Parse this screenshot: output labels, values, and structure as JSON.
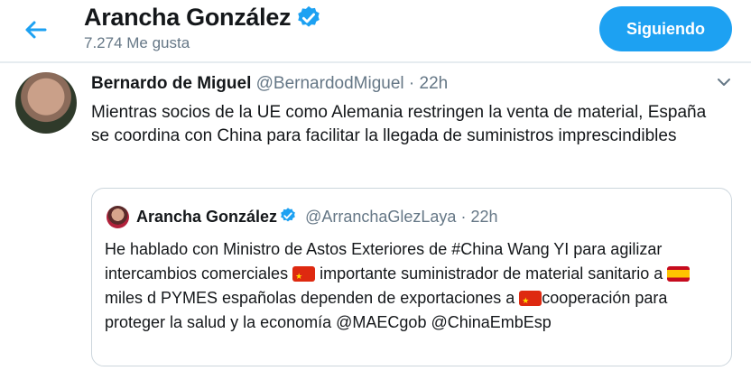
{
  "header": {
    "back_icon": "arrow-left-icon",
    "title": "Arancha González",
    "likes": "7.274 Me gusta",
    "follow_label": "Siguiendo",
    "accent": "#1da1f2"
  },
  "tweet": {
    "author_name": "Bernardo de Miguel",
    "author_handle": "@BernardodMiguel",
    "sep": "·",
    "time": "22h",
    "menu_icon": "chevron-down-icon",
    "text": "Mientras socios de la UE como Alemania restringen la venta de material, España se coordina con China para facilitar la llegada de suministros imprescindibles"
  },
  "quote": {
    "author_name": "Arancha González",
    "author_handle": "@ArranchaGlezLaya",
    "sep": "·",
    "time": "22h",
    "seg1": "He hablado con Ministro de Astos Exteriores de #China Wang YI para agilizar intercambios comerciales ",
    "seg2": " importante suministrador de material sanitario a ",
    "seg3": " miles d PYMES españolas dependen de exportaciones a ",
    "seg4": "cooperación para proteger la salud y la economía @MAECgob @ChinaEmbEsp"
  }
}
